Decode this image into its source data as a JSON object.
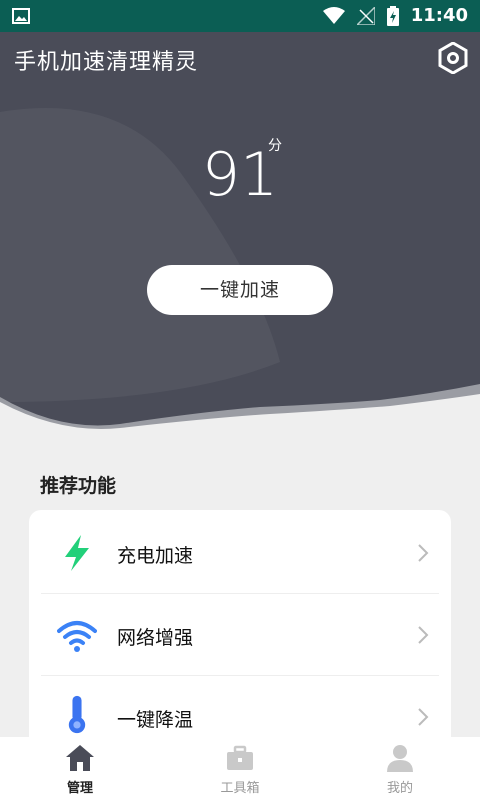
{
  "status_bar": {
    "time": "11:40",
    "bg_color": "#0b5e54"
  },
  "header": {
    "app_title": "手机加速清理精灵",
    "settings_icon": "settings-icon"
  },
  "score": {
    "value": "91",
    "unit": "分"
  },
  "boost_button": {
    "label": "一键加速"
  },
  "recommend": {
    "title": "推荐功能",
    "items": [
      {
        "label": "充电加速",
        "icon": "lightning-icon",
        "icon_color": "#22d07a"
      },
      {
        "label": "网络增强",
        "icon": "wifi-icon",
        "icon_color": "#3b82f6"
      },
      {
        "label": "一键降温",
        "icon": "thermometer-icon",
        "icon_color": "#3b74f0"
      }
    ]
  },
  "bottom_nav": {
    "tabs": [
      {
        "label": "管理",
        "icon": "home-icon",
        "active": true
      },
      {
        "label": "工具箱",
        "icon": "toolbox-icon",
        "active": false
      },
      {
        "label": "我的",
        "icon": "user-icon",
        "active": false
      }
    ]
  },
  "colors": {
    "hero_dark": "#4a4c58",
    "hero_light": "#5b5d68",
    "background": "#efefef"
  }
}
